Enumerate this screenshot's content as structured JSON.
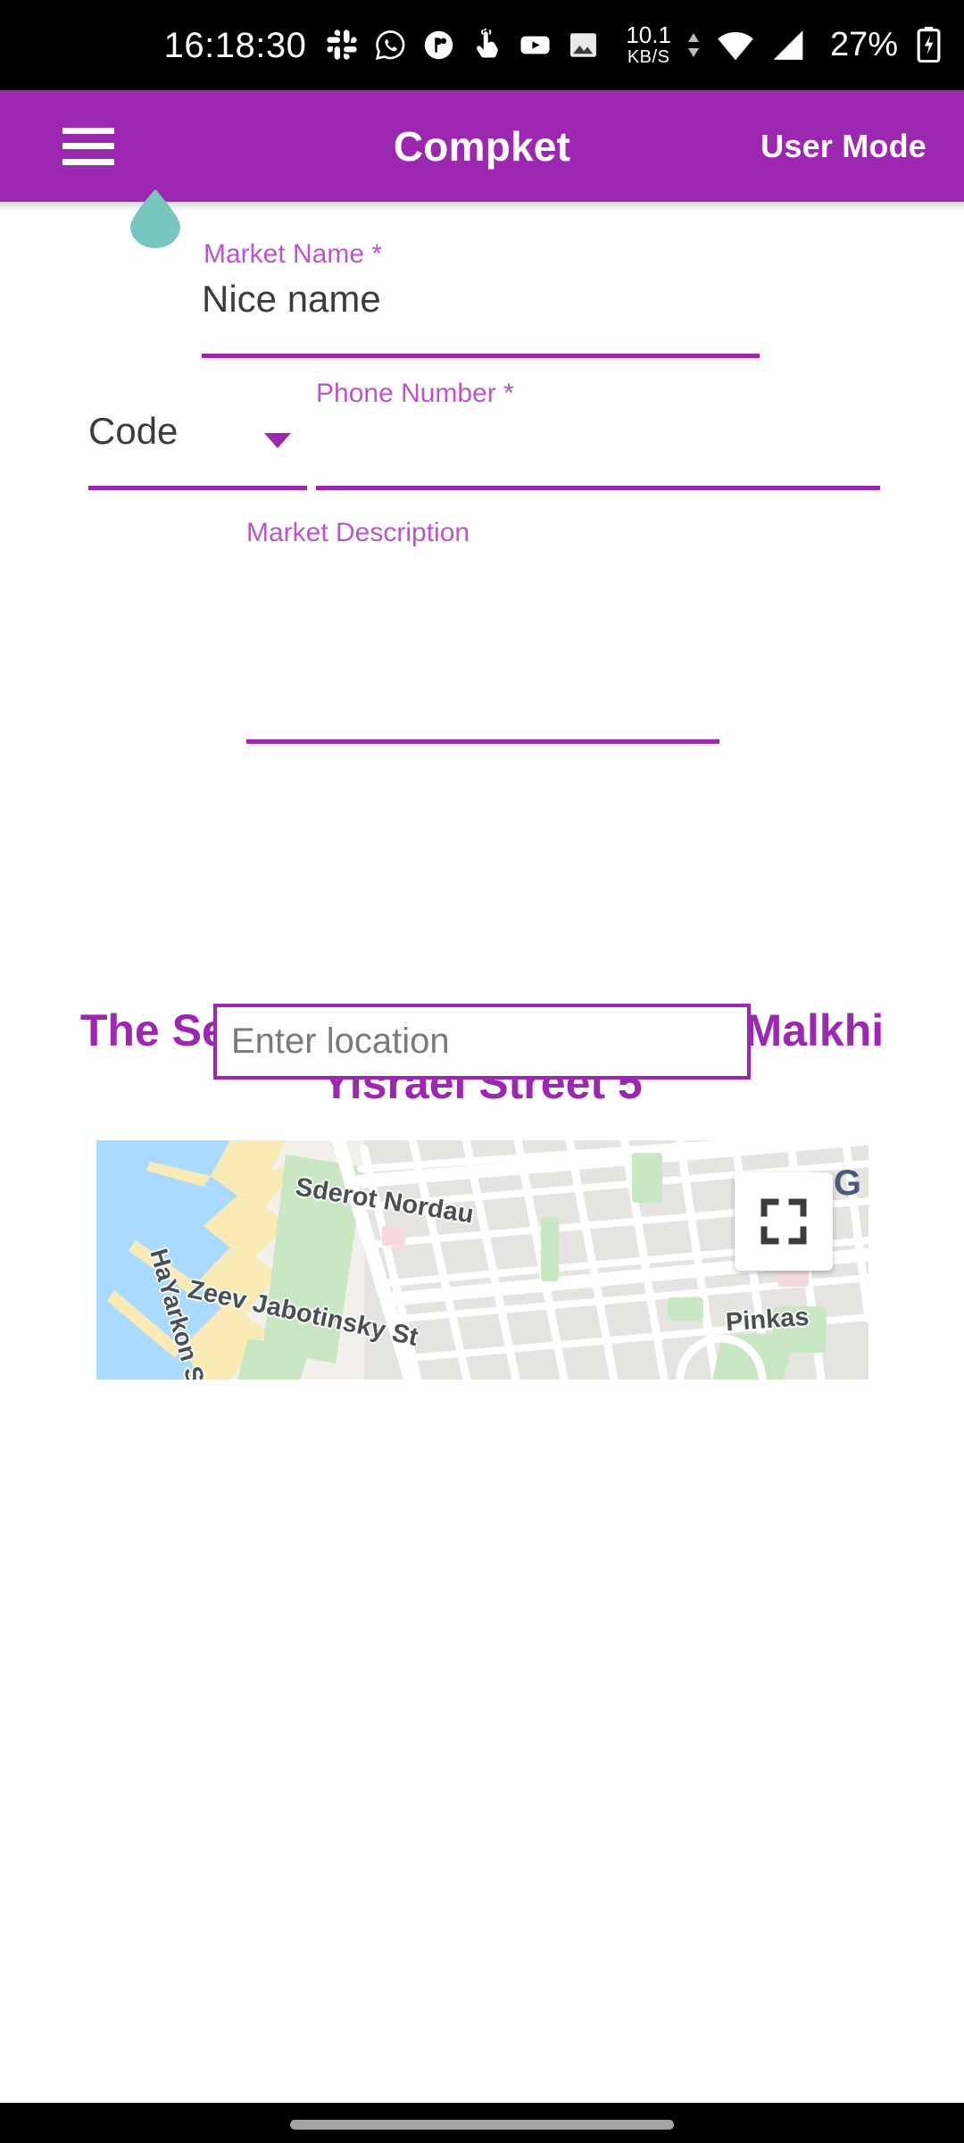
{
  "status_bar": {
    "time": "16:18:30",
    "app_icons": [
      "slack-icon",
      "whatsapp-icon",
      "circle-app-icon",
      "touch-hand-icon",
      "youtube-icon",
      "gallery-icon"
    ],
    "network_speed_value": "10.1",
    "network_speed_unit": "KB/S",
    "wifi_icon": "wifi-icon",
    "signal_icon": "cellular-signal-icon",
    "battery_percent": "27%",
    "battery_icon": "battery-charging-icon"
  },
  "app_bar": {
    "menu_icon": "hamburger-menu-icon",
    "title": "Compket",
    "user_mode_label": "User Mode",
    "background_color": "#9C27B0",
    "accent_marker_color": "#76C7C0"
  },
  "form": {
    "market_name": {
      "label": "Market Name *",
      "value": "Nice name",
      "placeholder": ""
    },
    "code": {
      "label": "Code",
      "value": "Code",
      "dropdown_icon": "chevron-down-icon"
    },
    "phone_number": {
      "label": "Phone Number *",
      "value": "",
      "placeholder": ""
    },
    "market_description": {
      "label": "Market Description",
      "value": "",
      "placeholder": ""
    },
    "label_color": "#BA55C8",
    "underline_color": "#9C27B0"
  },
  "location": {
    "selected_text": "The Selected location is: Israel Malkhi Yisrael Street 5",
    "input_placeholder": "Enter location",
    "input_value": "",
    "text_color": "#9C27B0"
  },
  "map": {
    "street_labels": [
      "Sderot Nordau",
      "HaYarkon St",
      "Zeev Jabotinsky St",
      "Pinkas"
    ],
    "provider_mark": "G",
    "fullscreen_icon": "fullscreen-expand-icon",
    "water_color": "#AADAFF",
    "sand_color": "#FAEAB5",
    "park_color": "#C8E6C0",
    "land_color": "#F2EFEA"
  },
  "nav_bar": {
    "handle_icon": "gesture-home-handle"
  }
}
